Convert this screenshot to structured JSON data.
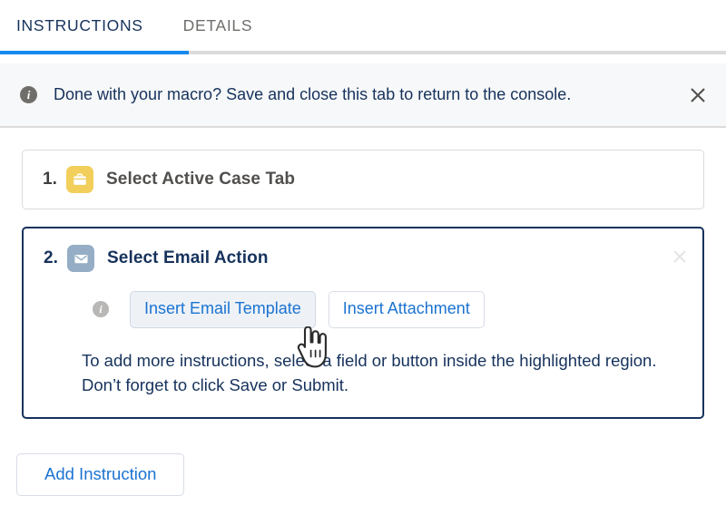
{
  "tabs": [
    {
      "label": "INSTRUCTIONS",
      "active": true,
      "name": "tab-instructions"
    },
    {
      "label": "DETAILS",
      "active": false,
      "name": "tab-details"
    }
  ],
  "banner": {
    "icon": "info-circle-icon",
    "message": "Done with your macro? Save and close this tab to return to the console.",
    "close_icon": "close-icon",
    "background_color": "#f7f8f9",
    "text_color": "#16325c"
  },
  "steps": [
    {
      "number": "1.",
      "icon": "case-briefcase-icon",
      "icon_color": "#f2cf5b",
      "title": "Select Active Case Tab",
      "selected": false
    },
    {
      "number": "2.",
      "icon": "email-envelope-icon",
      "icon_color": "#95aec5",
      "title": "Select Email Action",
      "selected": true,
      "close_icon": "close-icon",
      "row_info_icon": "info-circle-icon",
      "buttons": [
        {
          "label": "Insert Email Template",
          "state": "hover",
          "name": "insert-email-template-button"
        },
        {
          "label": "Insert Attachment",
          "state": "default",
          "name": "insert-attachment-button"
        }
      ],
      "hint": "To add more instructions, select a field or button inside the highlighted region. Don’t forget to click Save or Submit."
    }
  ],
  "footer": {
    "add_instruction_label": "Add Instruction"
  },
  "colors": {
    "accent_blue": "#1589ee",
    "link_blue": "#1b73d2",
    "navy": "#16325c",
    "border_gray": "#dddbda"
  },
  "cursor": {
    "type": "pointing-hand-cursor"
  }
}
